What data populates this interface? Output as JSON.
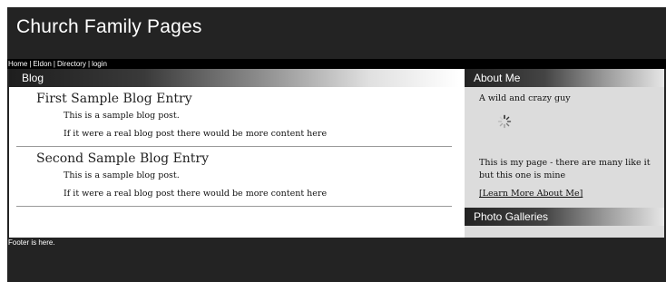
{
  "site": {
    "title": "Church Family Pages"
  },
  "nav": {
    "items": [
      "Home",
      "Eldon",
      "Directory",
      "login"
    ]
  },
  "blog": {
    "header": "Blog",
    "posts": [
      {
        "title": "First Sample Blog Entry",
        "lines": [
          "This is a sample blog post.",
          "If it were a real blog post there would be more content here"
        ]
      },
      {
        "title": "Second Sample Blog Entry",
        "lines": [
          "This is a sample blog post.",
          "If it were a real blog post there would be more content here"
        ]
      }
    ]
  },
  "sidebar": {
    "about_header": "About Me",
    "tagline": "A wild and crazy guy",
    "description": "This is my page - there are many like it but this one is mine",
    "learn_more": "[Learn More About Me]",
    "photo_header": "Photo Galleries"
  },
  "footer": {
    "text": "Footer is here."
  }
}
